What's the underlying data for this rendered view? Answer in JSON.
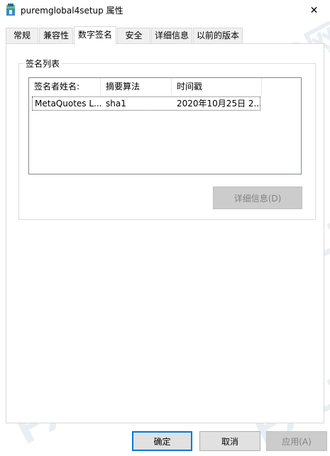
{
  "window": {
    "title": "puremglobal4setup 属性",
    "close_glyph": "✕"
  },
  "tabs": [
    {
      "label": "常规"
    },
    {
      "label": "兼容性"
    },
    {
      "label": "数字签名"
    },
    {
      "label": "安全"
    },
    {
      "label": "详细信息"
    },
    {
      "label": "以前的版本"
    }
  ],
  "active_tab": "数字签名",
  "signature_list": {
    "group_label": "签名列表",
    "columns": [
      "签名者姓名:",
      "摘要算法",
      "时间戳"
    ],
    "rows": [
      {
        "signer": "MetaQuotes L...",
        "algorithm": "sha1",
        "timestamp": "2020年10月25日 2..."
      }
    ]
  },
  "buttons": {
    "details": "详细信息(D)",
    "ok": "确定",
    "cancel": "取消",
    "apply": "应用(A)"
  },
  "watermark": {
    "text": "FX110网"
  },
  "colors": {
    "focus_border": "#0078d7",
    "disabled_button_bg": "#cccccc",
    "disabled_text": "#838383"
  }
}
